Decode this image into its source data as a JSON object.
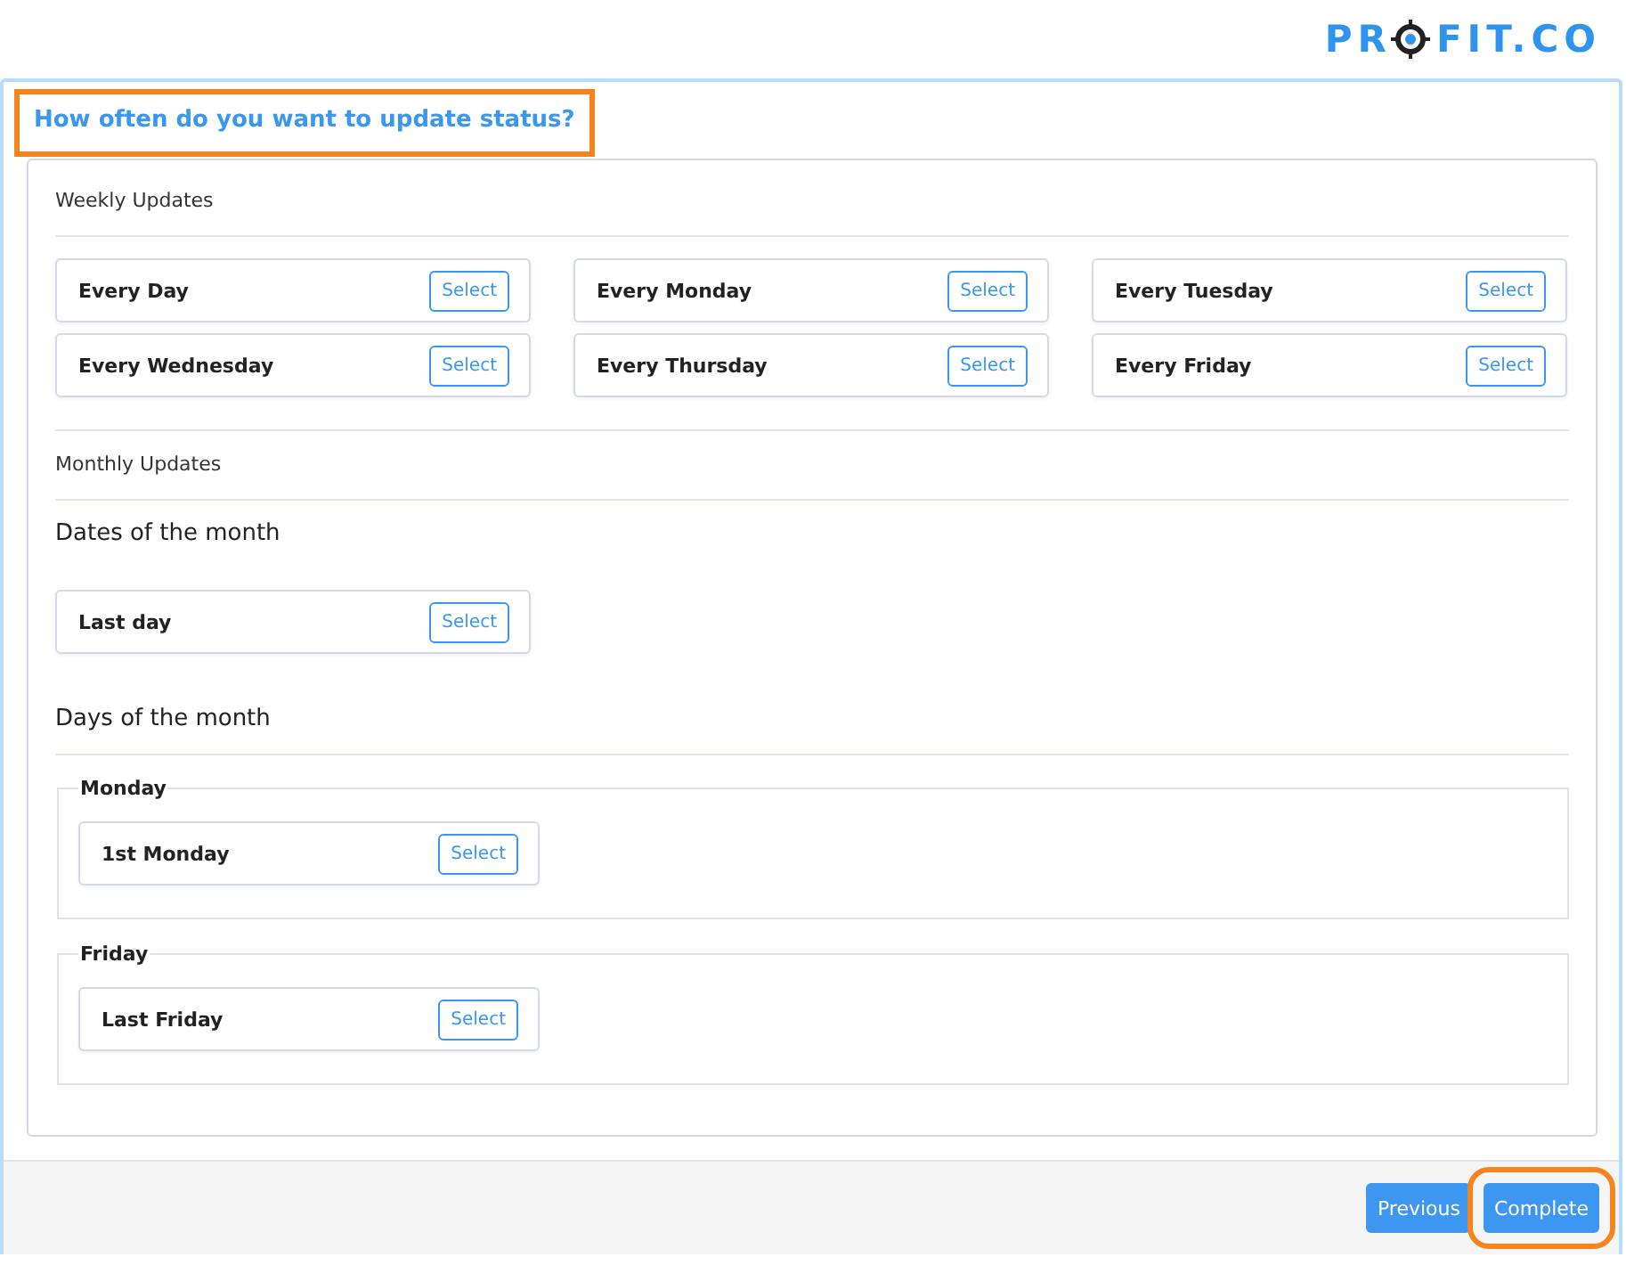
{
  "logo": {
    "before": "PR",
    "after": "FIT.CO"
  },
  "title": {
    "text": "How often do you want to update status?",
    "highlighted": true
  },
  "weekly": {
    "heading": "Weekly Updates",
    "options": [
      {
        "label": "Every Day",
        "action": "Select"
      },
      {
        "label": "Every Monday",
        "action": "Select"
      },
      {
        "label": "Every Tuesday",
        "action": "Select"
      },
      {
        "label": "Every Wednesday",
        "action": "Select"
      },
      {
        "label": "Every Thursday",
        "action": "Select"
      },
      {
        "label": "Every Friday",
        "action": "Select"
      }
    ]
  },
  "monthly": {
    "heading": "Monthly Updates",
    "dates": {
      "heading": "Dates of the month",
      "options": [
        {
          "label": "Last day",
          "action": "Select"
        }
      ]
    },
    "days": {
      "heading": "Days of the month",
      "groups": [
        {
          "legend": "Monday",
          "options": [
            {
              "label": "1st Monday",
              "action": "Select"
            }
          ]
        },
        {
          "legend": "Friday",
          "options": [
            {
              "label": "Last Friday",
              "action": "Select"
            }
          ]
        }
      ]
    }
  },
  "footer": {
    "buttons": [
      {
        "label": "Previous",
        "highlighted": false
      },
      {
        "label": "Complete",
        "highlighted": true
      }
    ]
  }
}
